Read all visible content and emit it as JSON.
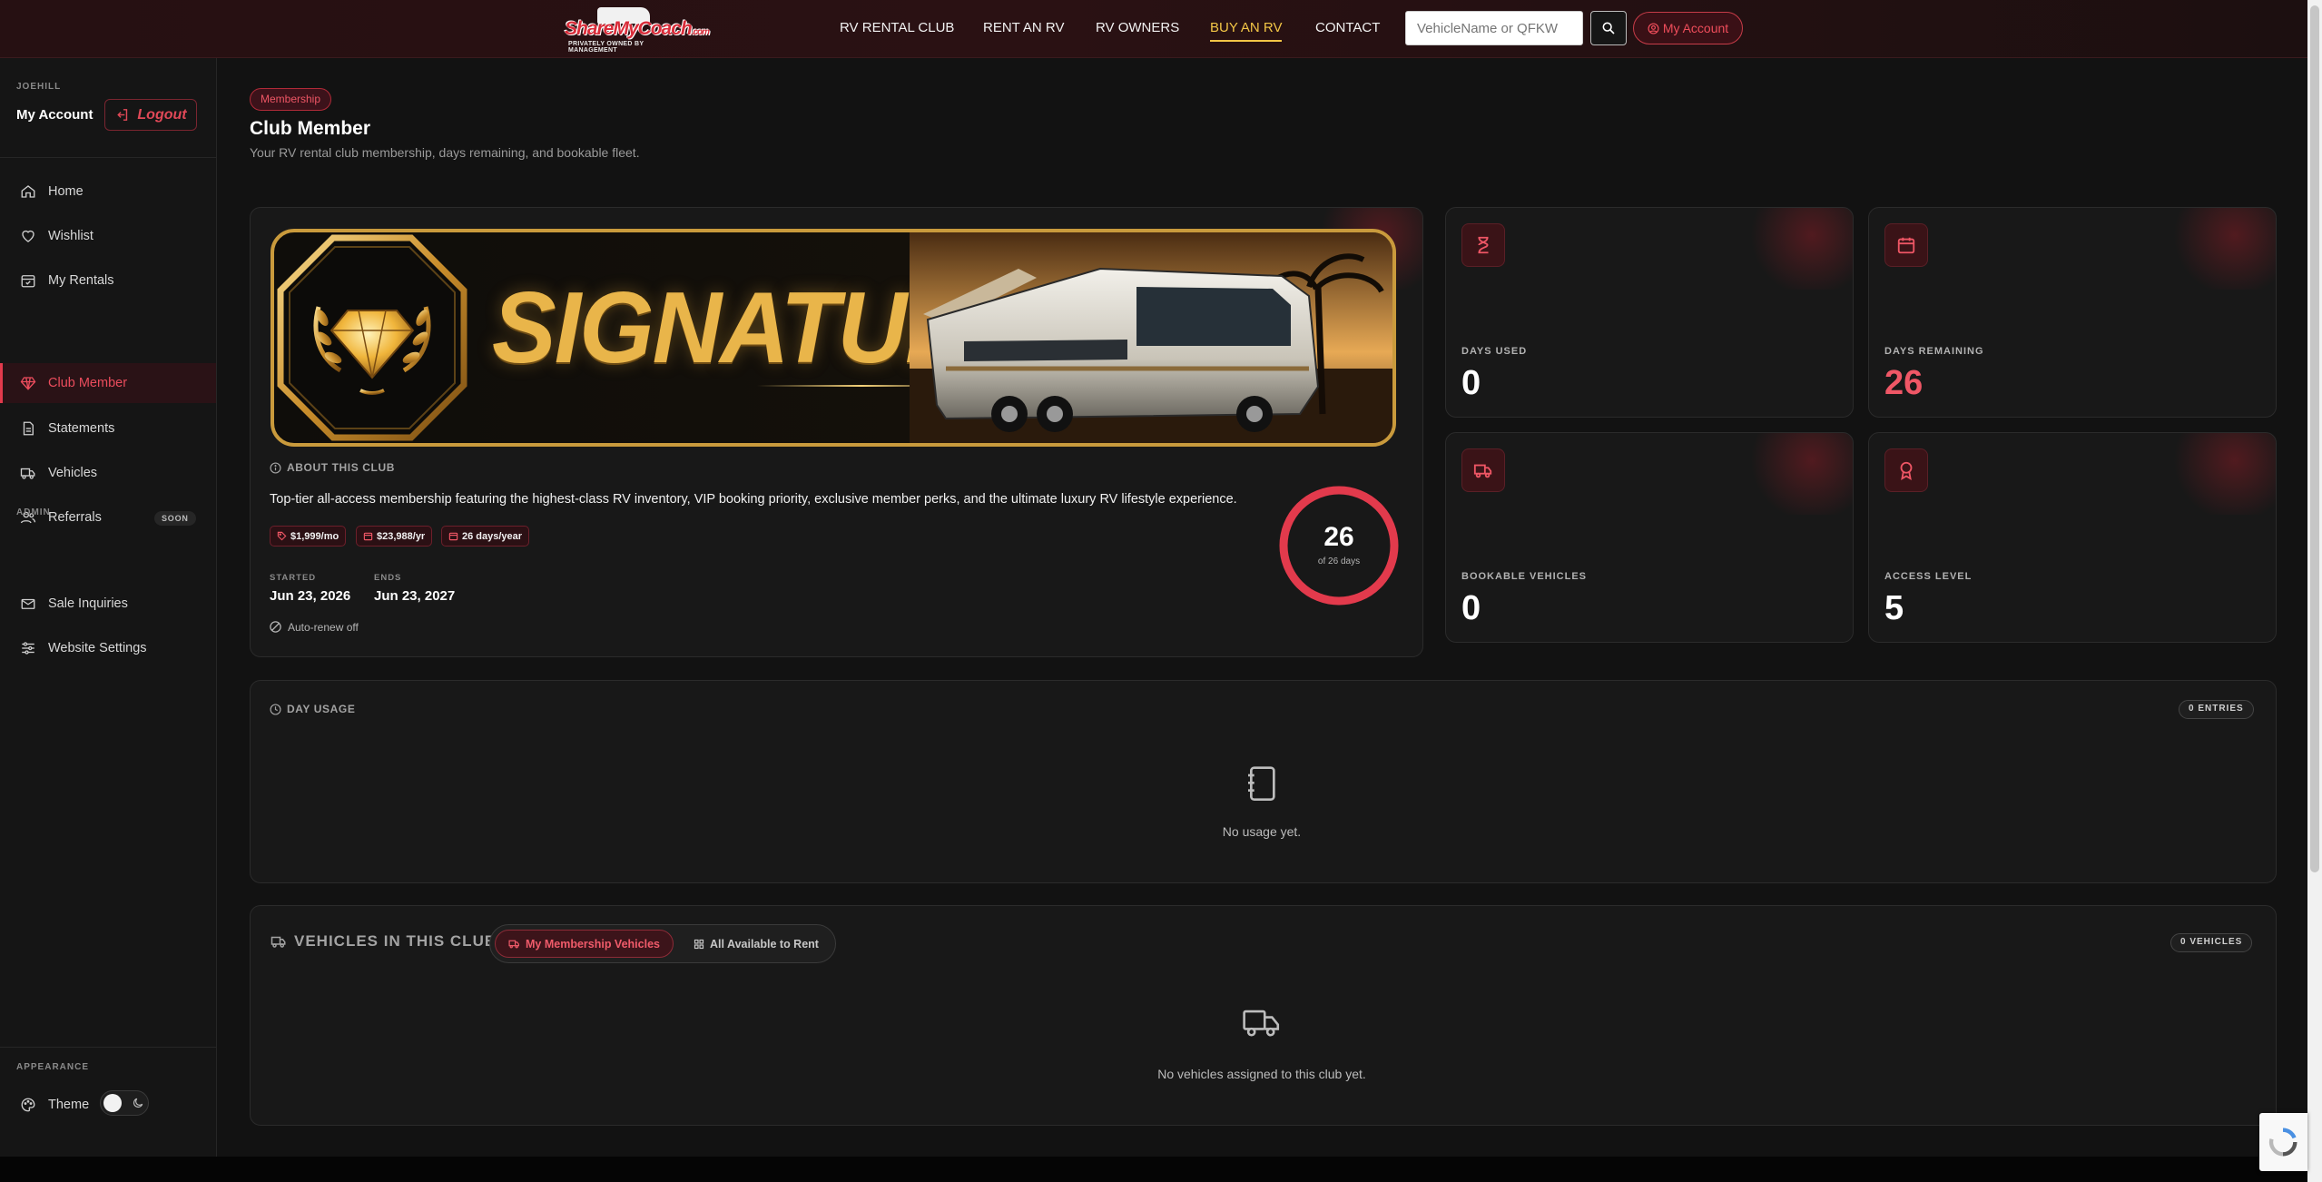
{
  "brand": {
    "logo_text": "ShareMyCoach",
    "logo_suffix": ".com",
    "logo_tagline": "PRIVATELY OWNED BY MANAGEMENT"
  },
  "nav": {
    "links": [
      "RV RENTAL CLUB",
      "RENT AN RV",
      "RV OWNERS",
      "BUY AN RV",
      "CONTACT"
    ],
    "active": "BUY AN RV",
    "search_placeholder": "VehicleName or QFKW",
    "account_label": "My Account"
  },
  "sidebar": {
    "username": "JOEHILL",
    "account_label": "My Account",
    "logout_label": "Logout",
    "items": [
      {
        "label": "Home",
        "icon": "home-icon"
      },
      {
        "label": "Wishlist",
        "icon": "heart-icon"
      },
      {
        "label": "My Rentals",
        "icon": "calendar-check-icon"
      },
      {
        "label": "Club Member",
        "icon": "gem-icon",
        "active": true
      },
      {
        "label": "Statements",
        "icon": "document-icon"
      },
      {
        "label": "Vehicles",
        "icon": "truck-icon"
      },
      {
        "label": "Referrals",
        "icon": "users-icon",
        "badge": "SOON"
      }
    ],
    "admin_section": "ADMIN",
    "admin_items": [
      {
        "label": "Sale Inquiries",
        "icon": "mail-icon"
      },
      {
        "label": "Website Settings",
        "icon": "sliders-icon"
      }
    ],
    "appearance_section": "APPEARANCE",
    "theme_label": "Theme"
  },
  "page": {
    "badge": "Membership",
    "title": "Club Member",
    "subtitle": "Your RV rental club membership, days remaining, and bookable fleet."
  },
  "membership": {
    "banner_text": "SIGNATURE",
    "about_heading": "ABOUT THIS CLUB",
    "description": "Top-tier all-access membership featuring the highest-class RV inventory, VIP booking priority, exclusive member perks, and the ultimate luxury RV lifestyle experience.",
    "tags": [
      "$1,999/mo",
      "$23,988/yr",
      "26 days/year"
    ],
    "started_label": "STARTED",
    "started": "Jun 23, 2026",
    "ends_label": "ENDS",
    "ends": "Jun 23, 2027",
    "auto_renew": "Auto-renew off",
    "ring_value": "26",
    "ring_caption": "of 26 days",
    "ring_fraction": 1.0
  },
  "stats": [
    {
      "label": "DAYS USED",
      "value": "0",
      "icon": "hourglass-icon"
    },
    {
      "label": "DAYS REMAINING",
      "value": "26",
      "icon": "calendar-icon",
      "highlight": true
    },
    {
      "label": "BOOKABLE VEHICLES",
      "value": "0",
      "icon": "truck-icon"
    },
    {
      "label": "ACCESS LEVEL",
      "value": "5",
      "icon": "award-icon"
    }
  ],
  "day_usage": {
    "heading": "DAY USAGE",
    "count": "0 ENTRIES",
    "empty": "No usage yet."
  },
  "vehicles": {
    "heading": "VEHICLES IN THIS CLUB",
    "tab_mine": "My Membership Vehicles",
    "tab_all": "All Available to Rent",
    "count": "0 VEHICLES",
    "empty": "No vehicles assigned to this club yet."
  },
  "colors": {
    "accent": "#e23a4c",
    "gold": "#f3c646",
    "bg": "#121212",
    "card": "#181818"
  }
}
